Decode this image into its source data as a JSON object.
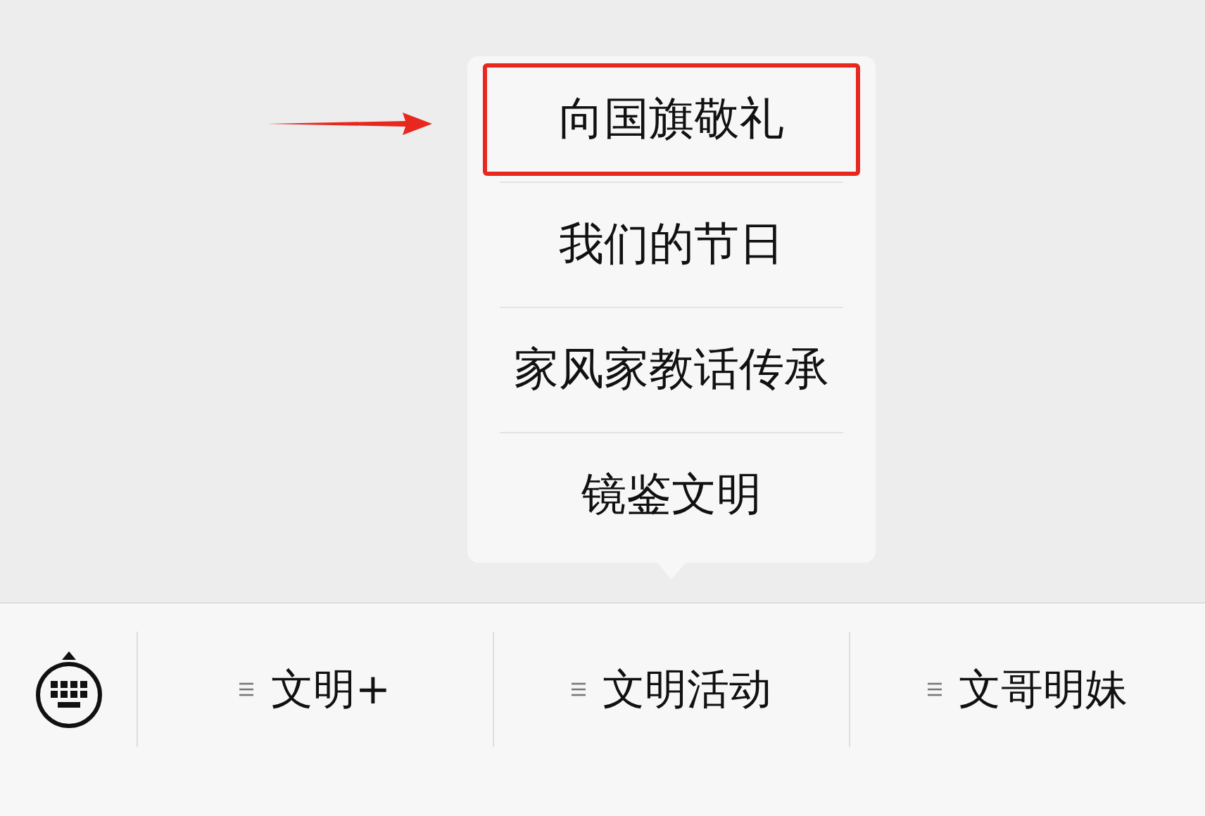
{
  "menus": [
    {
      "label": "文明+",
      "expanded": false
    },
    {
      "label": "文明活动",
      "expanded": true,
      "items": [
        {
          "label": "向国旗敬礼",
          "highlighted": true
        },
        {
          "label": "我们的节日",
          "highlighted": false
        },
        {
          "label": "家风家教话传承",
          "highlighted": false
        },
        {
          "label": "镜鉴文明",
          "highlighted": false
        }
      ]
    },
    {
      "label": "文哥明妹",
      "expanded": false
    }
  ]
}
